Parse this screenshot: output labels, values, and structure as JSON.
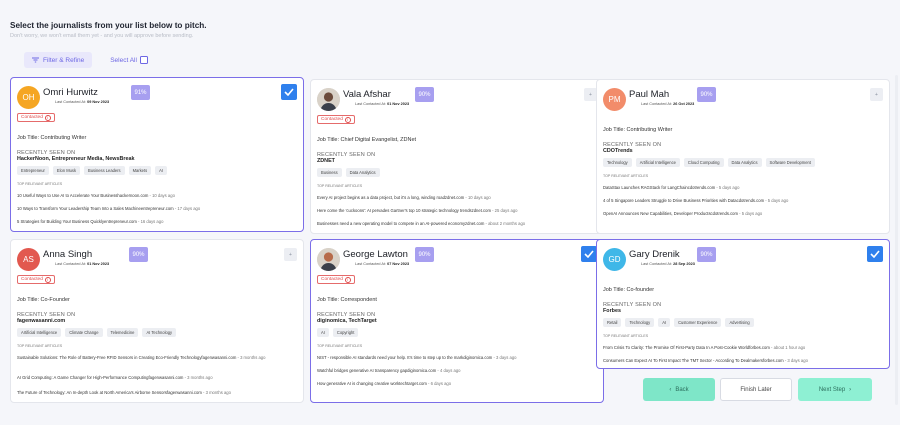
{
  "header": {
    "title": "Select the journalists from your list below to pitch.",
    "subtitle": "Don't worry, we won't email them yet - and you will approve before sending."
  },
  "toolbar": {
    "filter_label": "Filter & Refine",
    "select_all_label": "Select All"
  },
  "labels": {
    "last_contacted": "Last Contacted At",
    "contacted": "Contacted",
    "recently_seen": "RECENTLY SEEN ON",
    "top_articles": "TOP RELEVANT ARTICLES"
  },
  "colors": {
    "accent": "#7b6ee8",
    "score_bg": "#a79ff0",
    "check_bg": "#2f80ed",
    "contacted": "#e14848",
    "next_bg": "#8ef0d3"
  },
  "cards": [
    {
      "name": "Omri Hurwitz",
      "initials": "OH",
      "avatar_color": "#f5a623",
      "score": "91%",
      "last_contacted": "09 Nov 2023",
      "contacted": true,
      "selected": true,
      "job": "Job Title: Contributing Writer",
      "outlets": "HackerNoon, Entrepreneur Media, NewsBreak",
      "tags": [
        "Entrepreneur",
        "Elon Musk",
        "Business Leaders",
        "Markets",
        "AI"
      ],
      "articles": [
        {
          "text": "10 Useful Ways to Use AI to Accelerate Your Businesshackernoon.com",
          "ago": " - 10 days ago"
        },
        {
          "text": "10 Ways to Transform Your Leadership Team Into a Sales Machineentrepreneur.com",
          "ago": " - 17 days ago"
        },
        {
          "text": "5 Strategies for Building Your Business Quicklyentrepreneur.com",
          "ago": " - 16 days ago"
        }
      ]
    },
    {
      "name": "Vala Afshar",
      "initials": "",
      "avatar_color": "#6b4a3a",
      "score": "90%",
      "last_contacted": "01 Nov 2023",
      "contacted": true,
      "selected": false,
      "job": "Job Title: Chief Digital Evangelist, ZDNet",
      "outlets": "ZDNET",
      "tags": [
        "Business",
        "Data Analytics"
      ],
      "articles": [
        {
          "text": "Every AI project begins as a data project, but it's a long, winding roadzdnet.com",
          "ago": " - 10 days ago"
        },
        {
          "text": "Here come the 'cuckoons': AI pervades Gartner's top 10 strategic technology trendszdnet.com",
          "ago": " - 25 days ago"
        },
        {
          "text": "Businesses need a new operating model to compete in an AI-powered economyzdnet.com",
          "ago": " - about 2 months ago"
        }
      ]
    },
    {
      "name": "Paul Mah",
      "initials": "PM",
      "avatar_color": "#f28c6a",
      "score": "90%",
      "last_contacted": "26 Oct 2023",
      "contacted": false,
      "selected": false,
      "job": "Job Title: Contributing Writer",
      "outlets": "CDOTrends",
      "tags": [
        "Technology",
        "Artificial Intelligence",
        "Cloud Computing",
        "Data Analytics",
        "Software Development"
      ],
      "articles": [
        {
          "text": "DataStax Launches RAGStack for LangChaincdotrends.com",
          "ago": " - 5 days ago"
        },
        {
          "text": "4 of 5 Singapore Leaders Struggle to Drive Business Priorities with Datacdotrends.com",
          "ago": " - 5 days ago"
        },
        {
          "text": "OpenAI Announces New Capabilities, Developer Productscdotrends.com",
          "ago": " - 5 days ago"
        }
      ]
    },
    {
      "name": "Anna Singh",
      "initials": "AS",
      "avatar_color": "#e2584f",
      "score": "90%",
      "last_contacted": "01 Nov 2023",
      "contacted": true,
      "selected": false,
      "job": "Job Title: Co-Founder",
      "outlets": "fagenwasanni.com",
      "tags": [
        "Artificial Intelligence",
        "Climate Change",
        "Telemedicine",
        "AI Technology"
      ],
      "articles": [
        {
          "text": "Sustainable Solutions: The Role of Battery-Free RFID Sensors in Creating Eco-Friendly Technologyfagenwasanni.com",
          "ago": " - 3 months ago"
        },
        {
          "text": "AI Grid Computing: A Game Changer for High-Performance Computingfagenwasanni.com",
          "ago": " - 3 months ago"
        },
        {
          "text": "The Future of Technology: An In-depth Look at North America's Airborne Sensorsfagenwasanni.com",
          "ago": " - 3 months ago"
        }
      ]
    },
    {
      "name": "George Lawton",
      "initials": "",
      "avatar_color": "#b76b4a",
      "score": "90%",
      "last_contacted": "07 Nov 2023",
      "contacted": true,
      "selected": true,
      "job": "Job Title: Correspondent",
      "outlets": "diginomica, TechTarget",
      "tags": [
        "AI",
        "Copyright"
      ],
      "articles": [
        {
          "text": "NIST - responsible AI standards need your help. It's time to step up to the markdiginomica.com",
          "ago": " - 3 days ago"
        },
        {
          "text": "Watchful bridges generative AI transparency gapdiginomica.com",
          "ago": " - 4 days ago"
        },
        {
          "text": "How generative AI is changing creative worktechtarget.com",
          "ago": " - 6 days ago"
        }
      ]
    },
    {
      "name": "Gary Drenik",
      "initials": "GD",
      "avatar_color": "#3fb7e8",
      "score": "90%",
      "last_contacted": "28 Sep 2023",
      "contacted": false,
      "selected": true,
      "job": "Job Title: Co-founder",
      "outlets": "Forbes",
      "tags": [
        "Retail",
        "Technology",
        "AI",
        "Customer Experience",
        "Advertising"
      ],
      "articles": [
        {
          "text": "From Crisis To Clarity: The Promise Of First-Party Data In A Post-Cookie Worldforbes.com",
          "ago": " - about 1 hour ago"
        },
        {
          "text": "Consumers Can Expect AI To First Impact The TMT Sector - According To Dealmakersforbes.com",
          "ago": " - 3 days ago"
        },
        {
          "text": "CEO Of A Legacy Brand On Driving Meaningful Business Transformationforbes.com",
          "ago": " - 5 days ago"
        }
      ]
    }
  ],
  "footer": {
    "back_label": "Back",
    "later_label": "Finish Later",
    "next_label": "Next Step"
  }
}
